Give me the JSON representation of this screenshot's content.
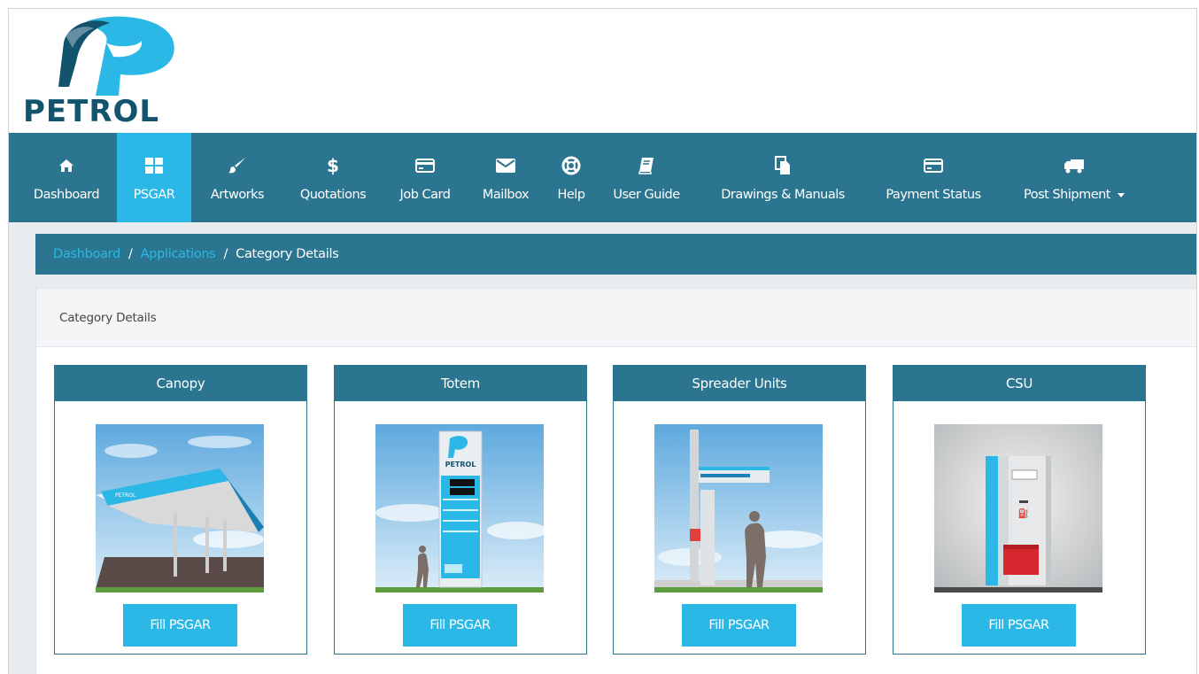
{
  "brand": {
    "name": "PETROL",
    "logo_icon": "petrol-p-logo"
  },
  "nav": {
    "items": [
      {
        "label": "Dashboard",
        "icon": "home-icon"
      },
      {
        "label": "PSGAR",
        "icon": "grid-icon",
        "active": true
      },
      {
        "label": "Artworks",
        "icon": "brush-icon"
      },
      {
        "label": "Quotations",
        "icon": "dollar-icon"
      },
      {
        "label": "Job Card",
        "icon": "credit-card-icon"
      },
      {
        "label": "Mailbox",
        "icon": "envelope-icon"
      },
      {
        "label": "Help",
        "icon": "lifebuoy-icon"
      },
      {
        "label": "User Guide",
        "icon": "book-icon"
      },
      {
        "label": "Drawings & Manuals",
        "icon": "files-icon"
      },
      {
        "label": "Payment Status",
        "icon": "credit-card-icon"
      },
      {
        "label": "Post Shipment",
        "icon": "truck-icon",
        "dropdown": true
      }
    ]
  },
  "breadcrumb": {
    "items": [
      "Dashboard",
      "Applications"
    ],
    "current": "Category Details"
  },
  "panel": {
    "title": "Category Details"
  },
  "categories": [
    {
      "title": "Canopy",
      "button": "Fill PSGAR"
    },
    {
      "title": "Totem",
      "button": "Fill PSGAR"
    },
    {
      "title": "Spreader Units",
      "button": "Fill PSGAR"
    },
    {
      "title": "CSU",
      "button": "Fill PSGAR"
    }
  ],
  "colors": {
    "nav_bg": "#2b7590",
    "accent": "#2bb8e6",
    "logo_dark": "#12536e"
  }
}
